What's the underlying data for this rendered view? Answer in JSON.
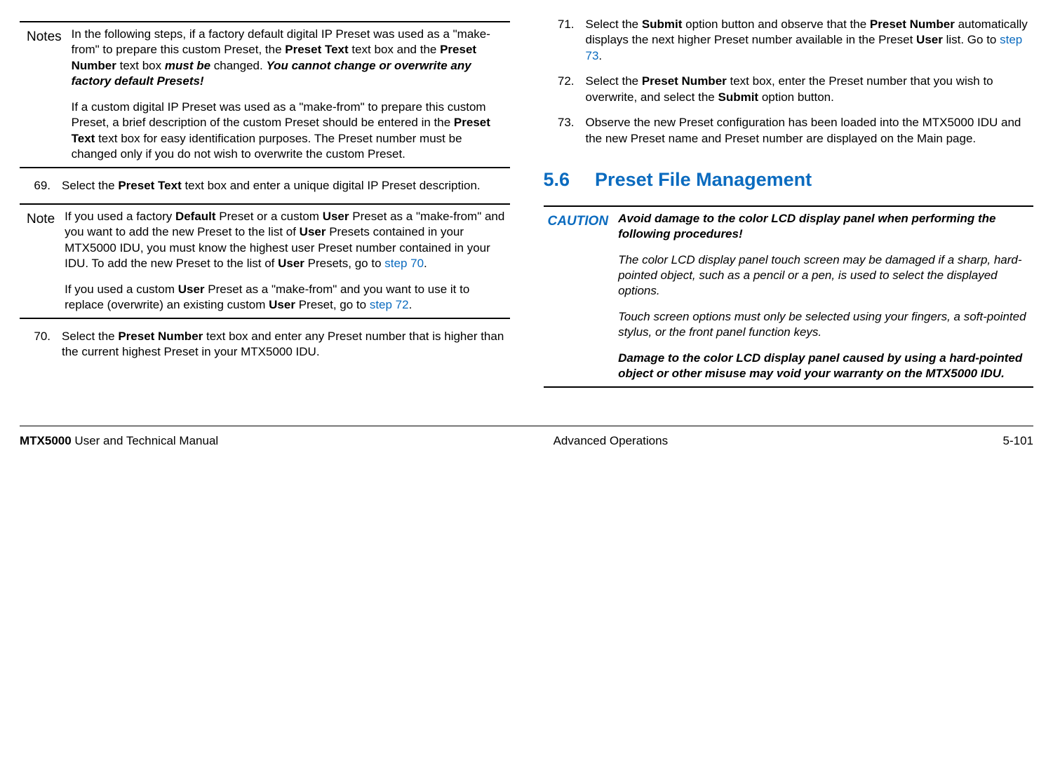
{
  "left": {
    "notes_label": "Notes",
    "notes_p1_a": "In the following steps, if a factory default digital IP Preset was used as a \"make-from\" to prepare this custom Preset, the ",
    "notes_p1_b": "Preset Text",
    "notes_p1_c": " text box and the ",
    "notes_p1_d": "Preset Number",
    "notes_p1_e": " text box ",
    "notes_p1_f": "must be",
    "notes_p1_g": " changed.  ",
    "notes_p1_h": "You cannot change or overwrite any factory default Presets!",
    "notes_p2_a": "If a custom digital IP Preset was used as a \"make-from\" to prepare this custom Preset, a brief description of the custom Preset should be entered in the ",
    "notes_p2_b": "Preset Text",
    "notes_p2_c": " text box for easy identification purposes.  The Preset number must be changed only if you do not wish to overwrite the custom Preset.",
    "s69_num": "69.",
    "s69_a": "Select the ",
    "s69_b": "Preset Text",
    "s69_c": " text box and enter a unique digital IP Preset description.",
    "note_label": "Note",
    "note_p1_a": "If you used a factory ",
    "note_p1_b": "Default",
    "note_p1_c": " Preset or a custom ",
    "note_p1_d": "User",
    "note_p1_e": " Preset as a \"make-from\" and you want to add the new Preset to the list of ",
    "note_p1_f": "User",
    "note_p1_g": " Presets contained in your MTX5000 IDU, you must know the highest user Preset number contained in your IDU.  To add the new Preset to the list of ",
    "note_p1_h": "User",
    "note_p1_i": " Presets, go to ",
    "note_p1_link": "step 70",
    "note_p1_j": ".",
    "note_p2_a": "If you used a custom ",
    "note_p2_b": "User",
    "note_p2_c": " Preset as a \"make-from\" and you want to use it to replace (overwrite) an existing custom ",
    "note_p2_d": "User",
    "note_p2_e": " Preset, go to ",
    "note_p2_link": "step 72",
    "note_p2_f": ".",
    "s70_num": "70.",
    "s70_a": "Select the ",
    "s70_b": "Preset Number",
    "s70_c": " text box and enter any Preset number that is higher than the current highest Preset in your MTX5000 IDU."
  },
  "right": {
    "s71_num": "71.",
    "s71_a": "Select the ",
    "s71_b": "Submit",
    "s71_c": " option button and observe that the ",
    "s71_d": "Preset Number",
    "s71_e": " automatically displays the next higher Preset number available in the Preset ",
    "s71_f": "User",
    "s71_g": " list.  Go to ",
    "s71_link": "step 73",
    "s71_h": ".",
    "s72_num": "72.",
    "s72_a": "Select the ",
    "s72_b": "Preset Number",
    "s72_c": " text box, enter the Preset number that you wish to overwrite, and select the ",
    "s72_d": "Submit",
    "s72_e": " option button.",
    "s73_num": "73.",
    "s73_a": "Observe the new Preset configuration has been loaded into the MTX5000 IDU and the new Preset name and Preset number are displayed on the Main page.",
    "heading_num": "5.6",
    "heading_title": "Preset File Management",
    "caution_label": "CAUTION",
    "caution_p1": "Avoid damage to the color LCD display panel when performing the following procedures!",
    "caution_p2": "The color LCD display panel touch screen may be damaged if a sharp, hard-pointed object, such as a pencil or a pen, is used to select the displayed options.",
    "caution_p3": "Touch screen options must only be selected using your fingers, a soft-pointed stylus, or the front panel function keys.",
    "caution_p4": "Damage to the color LCD display panel caused by using a hard-pointed object or other misuse may void your warranty on the MTX5000 IDU."
  },
  "footer": {
    "left_b": "MTX5000",
    "left_rest": " User and Technical Manual",
    "center": "Advanced Operations",
    "right": "5-101"
  }
}
